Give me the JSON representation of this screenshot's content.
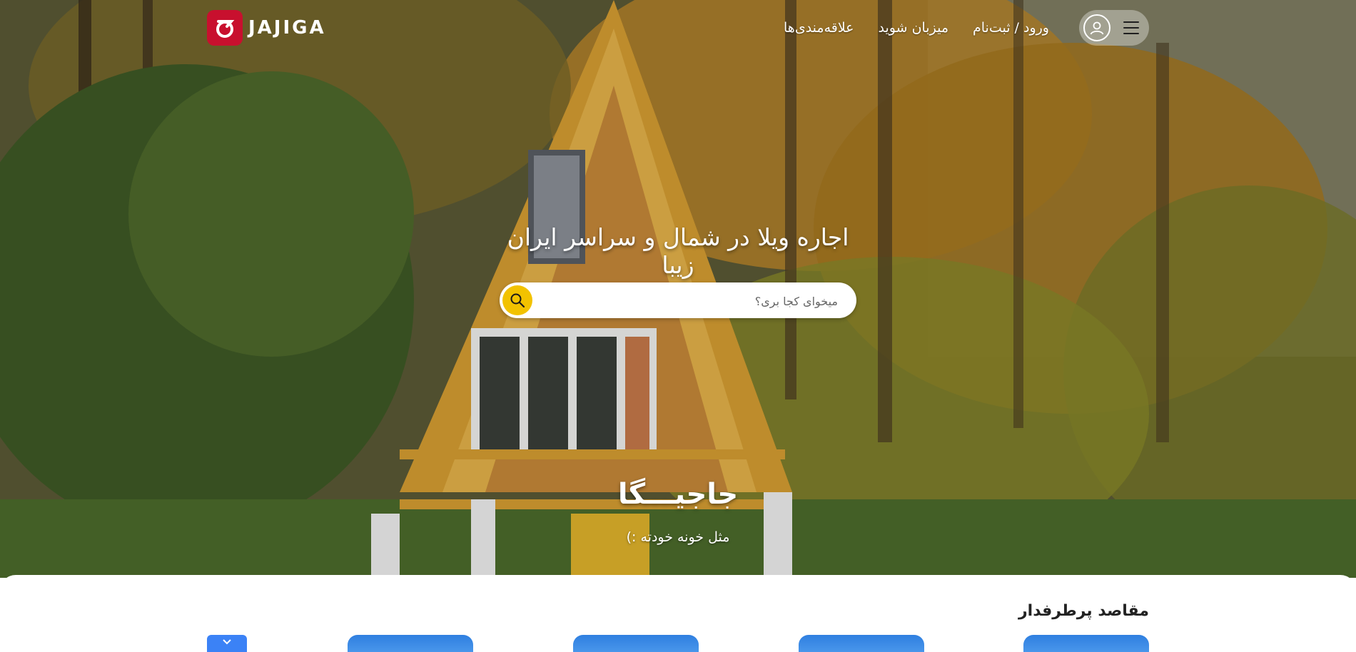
{
  "header": {
    "logo_text": "JAJIGA",
    "nav": {
      "favorites": "علاقه‌مندی‌ها",
      "host": "میزبان شوید",
      "login": "ورود / ثبت‌نام"
    }
  },
  "hero": {
    "headline": "اجاره ویلا در شمال و سراسر ایران زیبا",
    "search_placeholder": "میخوای کجا بری؟",
    "brand_name": "جاجیـــگا",
    "tagline": "مثل خونه خودته :)"
  },
  "section": {
    "title": "مقاصد پرطرفدار"
  },
  "icons": {
    "logo": "jajiga-logo-icon",
    "avatar": "user-avatar-icon",
    "menu": "hamburger-menu-icon",
    "search": "search-icon",
    "scroll": "chevron-down-icon"
  },
  "colors": {
    "brand_red": "#c8102e",
    "search_yellow": "#f2c200",
    "card_blue": "#2f7fe0"
  }
}
